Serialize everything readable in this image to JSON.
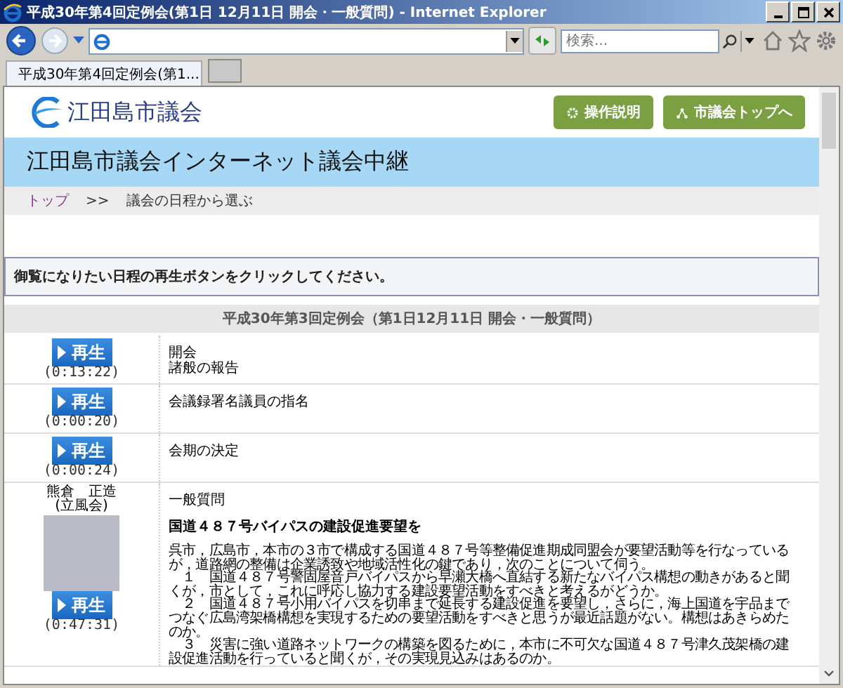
{
  "window": {
    "title": "平成30年第4回定例会(第1日 12月11日 開会・一般質問) - Internet Explorer"
  },
  "browser": {
    "search_placeholder": "検索...",
    "tab_title": "平成30年第4回定例会(第1..."
  },
  "site": {
    "logo": "江田島市議会",
    "buttons": [
      {
        "label": "操作説明",
        "kind": "gear"
      },
      {
        "label": "市議会トップへ",
        "kind": "home"
      }
    ]
  },
  "banner": "江田島市議会インターネット議会中継",
  "breadcrumb": [
    {
      "label": "トップ",
      "kind": "link"
    },
    {
      "label": ">>",
      "kind": "separator"
    },
    {
      "label": "議会の日程から選ぶ",
      "kind": "current"
    }
  ],
  "notice": "御覧になりたい日程の再生ボタンをクリックしてください。",
  "schedule": {
    "heading": "平成30年第3回定例会（第1日12月11日 開会・一般質問）",
    "rows": [
      {
        "play_label": "再生",
        "duration": "(0:13:22)",
        "items": [
          "開会",
          "諸般の報告"
        ]
      },
      {
        "play_label": "再生",
        "duration": "(0:00:20)",
        "items": [
          "会議録署名議員の指名"
        ]
      },
      {
        "play_label": "再生",
        "duration": "(0:00:24)",
        "items": [
          "会期の決定"
        ]
      },
      {
        "speaker": {
          "name": "熊倉　正造",
          "faction": "(立風会)"
        },
        "play_label": "再生",
        "duration": "(0:47:31)",
        "items": [
          "一般質問"
        ],
        "question_title": "国道４８７号バイパスの建設促進要望を",
        "question_lines": [
          "呉市，広島市，本市の３市で構成する国道４８７号等整備促進期成同盟会が要望活動等を行なっている",
          "が，道路網の整備は企業誘致や地域活性化の鍵であり，次のことについて伺う。",
          "　１　国道４８７号警固屋音戸バイパスから早瀬大橋へ直結する新たなバイパス構想の動きがあると聞",
          "くが，市として，これに呼応し協力する建設要望活動をすべきと考えるがどうか。",
          "　２　国道４８７号小用バイパスを切串まで延長する建設促進を要望し，さらに，海上国道を宇品まで",
          "つなぐ広島湾架橋構想を実現するための要望活動をすべきと思うが最近話題がない。構想はあきらめた",
          "のか。",
          "　３　災害に強い道路ネットワークの構築を図るために，本市に不可欠な国道４８７号津久茂架橋の建",
          "設促進活動を行っていると聞くが，その実現見込みはあるのか。"
        ]
      }
    ]
  }
}
